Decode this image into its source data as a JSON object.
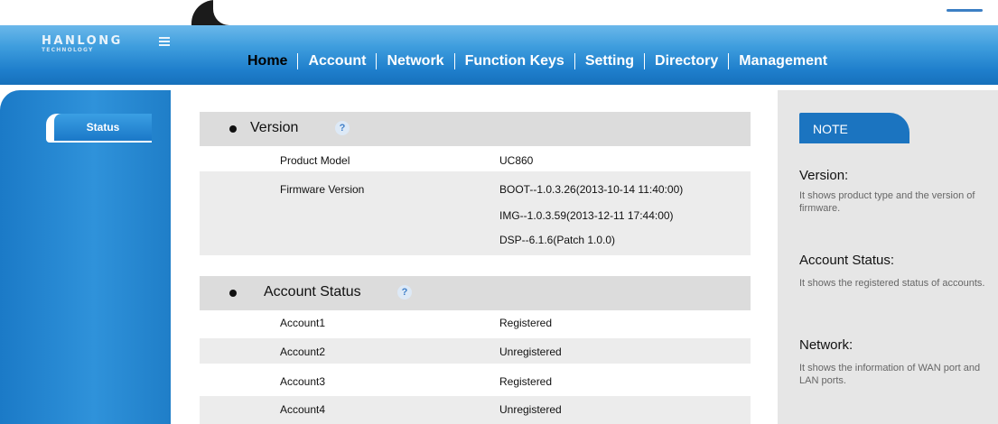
{
  "brand": {
    "name": "HANLONG",
    "tagline": "TECHNOLOGY"
  },
  "nav": {
    "items": [
      {
        "label": "Home"
      },
      {
        "label": "Account"
      },
      {
        "label": "Network"
      },
      {
        "label": "Function Keys"
      },
      {
        "label": "Setting"
      },
      {
        "label": "Directory"
      },
      {
        "label": "Management"
      }
    ],
    "active": "Home"
  },
  "sidebar": {
    "items": [
      {
        "label": "Status"
      }
    ]
  },
  "version": {
    "title": "Version",
    "rows": [
      {
        "key": "Product Model",
        "value": "UC860"
      },
      {
        "key": "Firmware Version",
        "values": [
          "BOOT--1.0.3.26(2013-10-14 11:40:00)",
          "IMG--1.0.3.59(2013-12-11 17:44:00)",
          "DSP--6.1.6(Patch 1.0.0)"
        ]
      }
    ]
  },
  "account_status": {
    "title": "Account Status",
    "rows": [
      {
        "key": "Account1",
        "value": "Registered"
      },
      {
        "key": "Account2",
        "value": "Unregistered"
      },
      {
        "key": "Account3",
        "value": "Registered"
      },
      {
        "key": "Account4",
        "value": "Unregistered"
      }
    ]
  },
  "note": {
    "title": "NOTE",
    "sections": [
      {
        "heading": "Version:",
        "text": "It shows product type and the version of firmware."
      },
      {
        "heading": "Account Status:",
        "text": "It shows the registered status of accounts."
      },
      {
        "heading": "Network:",
        "text": "It shows the information of WAN port and LAN ports."
      }
    ]
  },
  "colors": {
    "navbar": "#2f8fd8",
    "sidebar": "#2583cf",
    "note_tab": "#1b74c0",
    "section_header": "#dcdcdc",
    "note_panel": "#e6e6e6"
  }
}
